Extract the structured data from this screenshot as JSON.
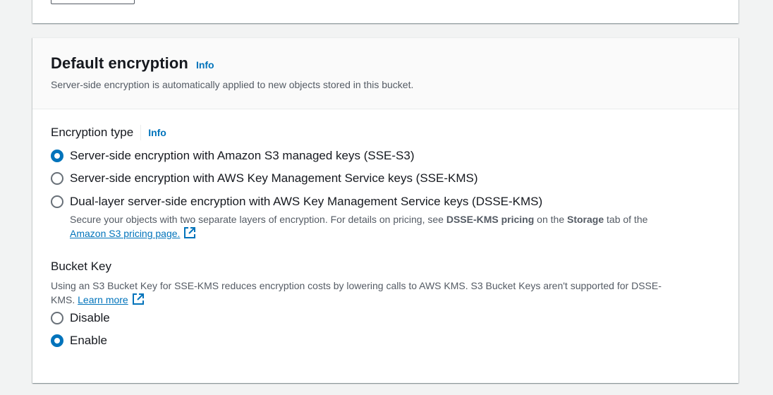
{
  "section": {
    "title": "Default encryption",
    "info_label": "Info",
    "description": "Server-side encryption is automatically applied to new objects stored in this bucket."
  },
  "encryption_type": {
    "label": "Encryption type",
    "info_label": "Info",
    "options": [
      {
        "label": "Server-side encryption with Amazon S3 managed keys (SSE-S3)",
        "selected": true
      },
      {
        "label": "Server-side encryption with AWS Key Management Service keys (SSE-KMS)",
        "selected": false
      },
      {
        "label": "Dual-layer server-side encryption with AWS Key Management Service keys (DSSE-KMS)",
        "selected": false
      }
    ],
    "dsse_desc": {
      "part1": "Secure your objects with two separate layers of encryption. For details on pricing, see ",
      "bold1": "DSSE-KMS pricing",
      "part2": " on the ",
      "bold2": "Storage",
      "part3": " tab of the",
      "link": "Amazon S3 pricing page."
    }
  },
  "bucket_key": {
    "label": "Bucket Key",
    "description_line1": "Using an S3 Bucket Key for SSE-KMS reduces encryption costs by lowering calls to AWS KMS. S3 Bucket Keys aren't supported for DSSE-",
    "description_line2": "KMS.",
    "learn_more": "Learn more",
    "options": [
      {
        "label": "Disable",
        "selected": false
      },
      {
        "label": "Enable",
        "selected": true
      }
    ]
  },
  "colors": {
    "accent": "#0073bb",
    "text": "#16191f",
    "secondary_text": "#545b64",
    "background": "#f2f3f3"
  }
}
